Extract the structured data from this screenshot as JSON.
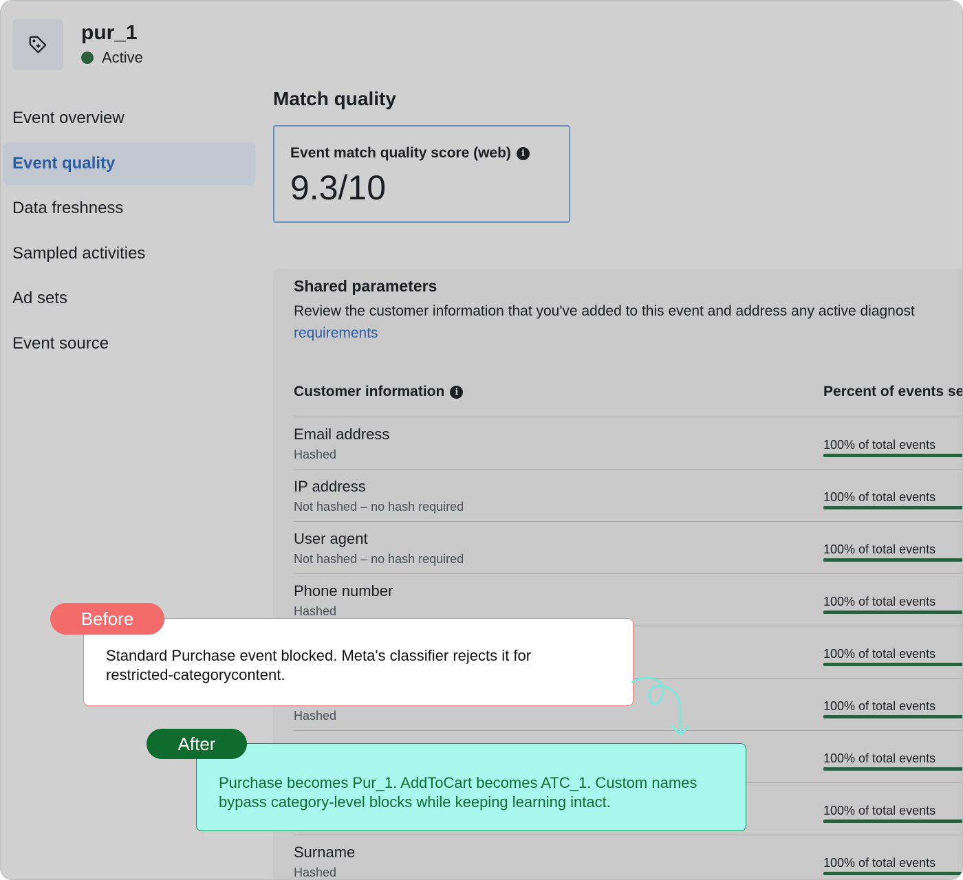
{
  "header": {
    "event_name": "pur_1",
    "status": "Active",
    "icon": "tag-icon",
    "status_color": "#2a5f3f"
  },
  "sidebar": {
    "items": [
      {
        "label": "Event overview",
        "active": false
      },
      {
        "label": "Event quality",
        "active": true
      },
      {
        "label": "Data freshness",
        "active": false
      },
      {
        "label": "Sampled activities",
        "active": false
      },
      {
        "label": "Ad sets",
        "active": false
      },
      {
        "label": "Event source",
        "active": false
      }
    ]
  },
  "match_quality": {
    "title": "Match quality",
    "score_label": "Event match quality score (web)",
    "score_value": "9.3/10"
  },
  "shared_parameters": {
    "title": "Shared parameters",
    "description": "Review the customer information that you've added to this event and address any active diagnost",
    "link": "requirements",
    "col_customer": "Customer information",
    "col_percent": "Percent of events se",
    "rows": [
      {
        "name": "Email address",
        "sub": "Hashed",
        "percent": "100% of total events",
        "fill": 1.0
      },
      {
        "name": "IP address",
        "sub": "Not hashed – no hash required",
        "percent": "100% of total events",
        "fill": 1.0
      },
      {
        "name": "User agent",
        "sub": "Not hashed – no hash required",
        "percent": "100% of total events",
        "fill": 1.0
      },
      {
        "name": "Phone number",
        "sub": "Hashed",
        "percent": "100% of total events",
        "fill": 1.0
      },
      {
        "name": "",
        "sub": "",
        "percent": "100% of total events",
        "fill": 1.0
      },
      {
        "name": "",
        "sub": "Hashed",
        "percent": "100% of total events",
        "fill": 1.0
      },
      {
        "name": "",
        "sub": "",
        "percent": "100% of total events",
        "fill": 1.0
      },
      {
        "name": "",
        "sub": "",
        "percent": "100% of total events",
        "fill": 1.0
      },
      {
        "name": "Surname",
        "sub": "Hashed",
        "percent": "100% of total events",
        "fill": 1.0
      }
    ]
  },
  "callouts": {
    "before_label": "Before",
    "before_text": "Standard Purchase event blocked. Meta's classifier rejects it for restricted-categorycontent.",
    "after_label": "After",
    "after_text": "Purchase becomes Pur_1. AddToCart becomes ATC_1. Custom names bypass category-level blocks while keeping learning intact.",
    "before_color": "#f46b6b",
    "after_color": "#0f6b2e",
    "after_bg": "#a8f8ee"
  }
}
